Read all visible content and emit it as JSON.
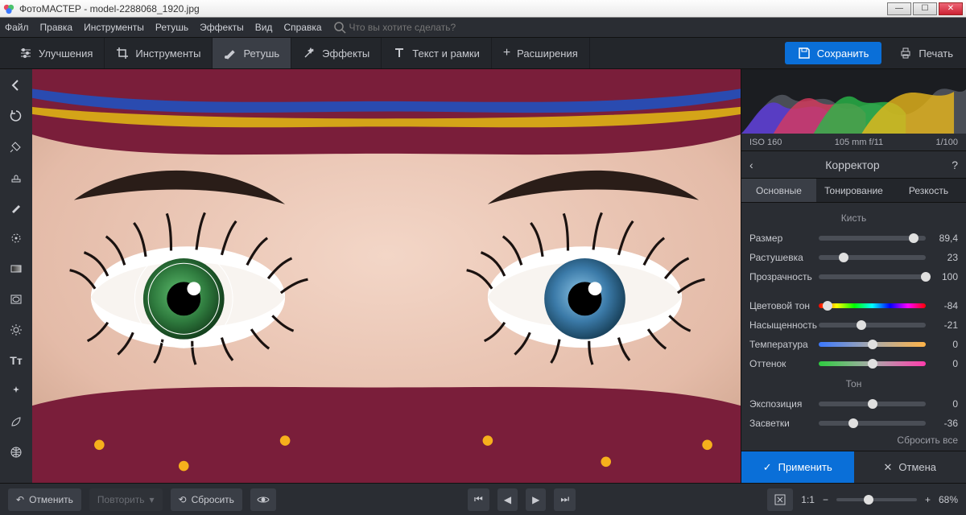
{
  "window": {
    "title": "ФотоМАСТЕР - model-2288068_1920.jpg"
  },
  "menu": {
    "file": "Файл",
    "edit": "Правка",
    "tools": "Инструменты",
    "retouch": "Ретушь",
    "effects": "Эффекты",
    "view": "Вид",
    "help": "Справка",
    "search_placeholder": "Что вы хотите сделать?"
  },
  "tabs": {
    "enhance": "Улучшения",
    "tools": "Инструменты",
    "retouch": "Ретушь",
    "effects": "Эффекты",
    "text": "Текст и рамки",
    "ext": "Расширения",
    "save": "Сохранить",
    "print": "Печать"
  },
  "exif": {
    "iso": "ISO 160",
    "lens": "105 mm f/11",
    "shutter": "1/100"
  },
  "panel": {
    "title": "Корректор",
    "tabs": {
      "basic": "Основные",
      "toning": "Тонирование",
      "sharp": "Резкость"
    }
  },
  "sections": {
    "brush": "Кисть",
    "tone": "Тон"
  },
  "sliders": {
    "size": {
      "label": "Размер",
      "value": "89,4",
      "pos": 89
    },
    "feather": {
      "label": "Растушевка",
      "value": "23",
      "pos": 23
    },
    "opacity": {
      "label": "Прозрачность",
      "value": "100",
      "pos": 100
    },
    "hue": {
      "label": "Цветовой тон",
      "value": "-84",
      "pos": 8,
      "cls": "hue"
    },
    "sat": {
      "label": "Насыщенность",
      "value": "-21",
      "pos": 40
    },
    "temp": {
      "label": "Температура",
      "value": "0",
      "pos": 50,
      "cls": "temp"
    },
    "tint": {
      "label": "Оттенок",
      "value": "0",
      "pos": 50,
      "cls": "tint"
    },
    "expo": {
      "label": "Экспозиция",
      "value": "0",
      "pos": 50
    },
    "high": {
      "label": "Засветки",
      "value": "-36",
      "pos": 32
    }
  },
  "reset": "Сбросить все",
  "apply": {
    "ok": "Применить",
    "cancel": "Отмена"
  },
  "bottom": {
    "undo": "Отменить",
    "redo": "Повторить",
    "reset": "Сбросить",
    "ratio": "1:1",
    "zoom": "68%"
  }
}
